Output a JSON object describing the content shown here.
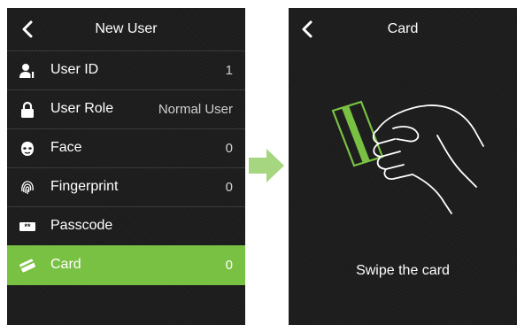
{
  "left_screen": {
    "header": {
      "title": "New User"
    },
    "rows": [
      {
        "label": "User ID",
        "value": "1",
        "icon": "user-id-icon"
      },
      {
        "label": "User Role",
        "value": "Normal User",
        "icon": "lock-icon"
      },
      {
        "label": "Face",
        "value": "0",
        "icon": "face-icon"
      },
      {
        "label": "Fingerprint",
        "value": "0",
        "icon": "fingerprint-icon"
      },
      {
        "label": "Passcode",
        "value": "",
        "icon": "passcode-icon"
      },
      {
        "label": "Card",
        "value": "0",
        "icon": "card-icon",
        "selected": true
      }
    ]
  },
  "right_screen": {
    "header": {
      "title": "Card"
    },
    "prompt": "Swipe the card"
  },
  "colors": {
    "accent": "#79c143",
    "screen_bg": "#1b1b1b",
    "arrow": "#a6d67f"
  }
}
